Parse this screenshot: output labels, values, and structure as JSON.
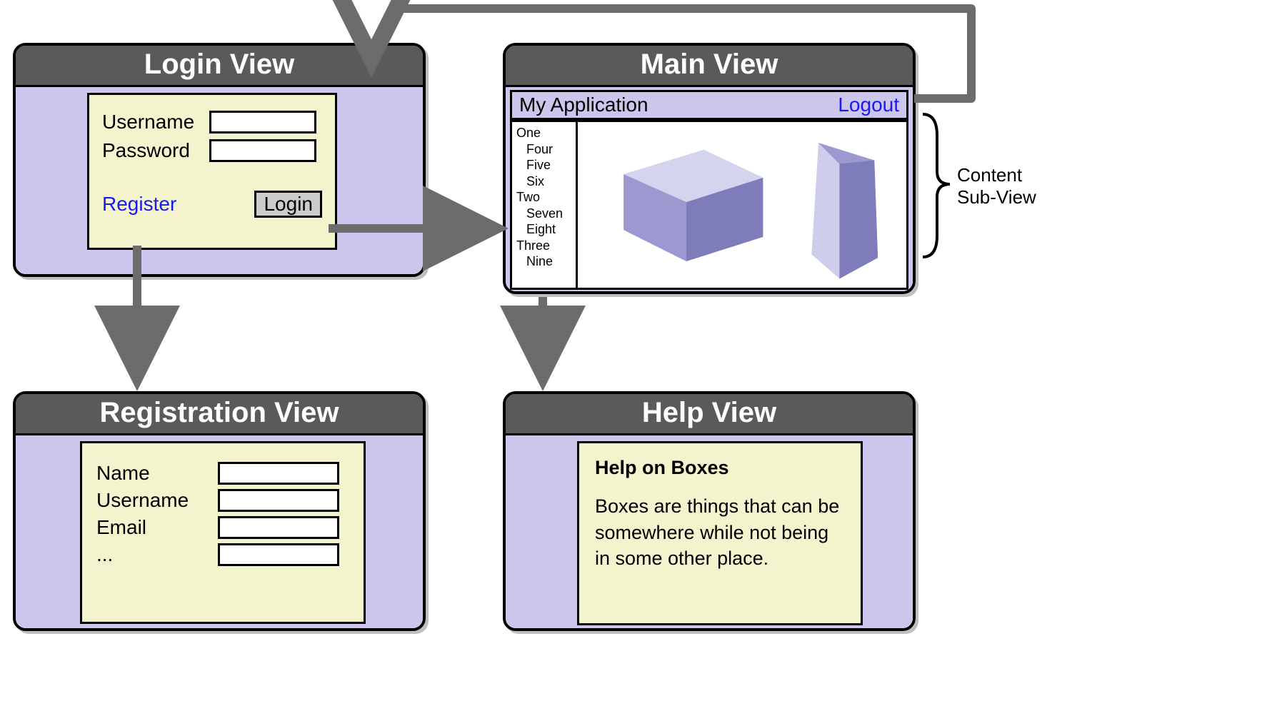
{
  "login_view": {
    "title": "Login View",
    "username_label": "Username",
    "password_label": "Password",
    "register_link": "Register",
    "login_button": "Login"
  },
  "registration_view": {
    "title": "Registration View",
    "name_label": "Name",
    "username_label": "Username",
    "email_label": "Email",
    "more_label": "..."
  },
  "main_view": {
    "title": "Main View",
    "app_name": "My Application",
    "logout_link": "Logout",
    "tree": {
      "l0_0": "One",
      "l1_0": "Four",
      "l1_1": "Five",
      "l1_2": "Six",
      "l0_1": "Two",
      "l1_3": "Seven",
      "l1_4": "Eight",
      "l0_2": "Three",
      "l1_5": "Nine"
    }
  },
  "help_view": {
    "title": "Help View",
    "help_title": "Help on Boxes",
    "help_body": "Boxes are things that can be somewhere while not being in some other place."
  },
  "annotations": {
    "content_subview": "Content\nSub-View"
  }
}
